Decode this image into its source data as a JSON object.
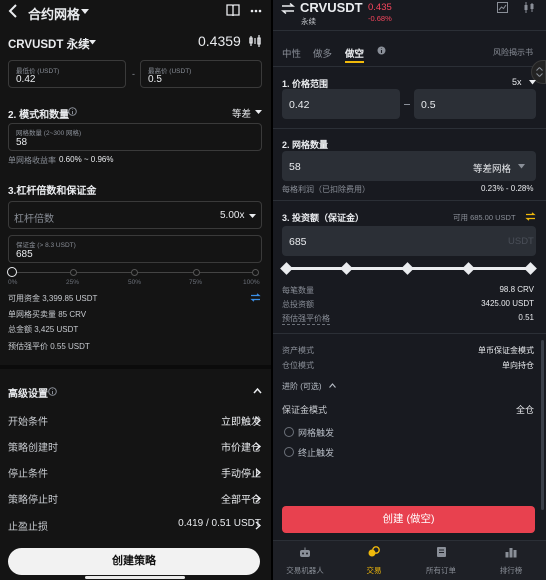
{
  "left": {
    "header": {
      "title": "合约网格"
    },
    "pair": {
      "symbol": "CRVUSDT 永续",
      "price": "0.4359"
    },
    "range": {
      "low_label": "最低价 (USDT)",
      "low_value": "0.42",
      "sep": "-",
      "high_label": "最高价 (USDT)",
      "high_value": "0.5"
    },
    "mode": {
      "title": "2. 模式和数量",
      "mode_value": "等差",
      "grid_label": "网格数量 (2~300 网格)",
      "grid_value": "58",
      "profit_label": "单网格收益率",
      "profit_value": "0.60% ~ 0.96%"
    },
    "leverage": {
      "title": "3.杠杆倍数和保证金",
      "lev_label": "杠杆倍数",
      "lev_value": "5.00x",
      "margin_label": "保证金 (> 8.3 USDT)",
      "margin_value": "685",
      "slider_marks": [
        "0%",
        "25%",
        "50%",
        "75%",
        "100%"
      ]
    },
    "info": {
      "available": "可用资金 3,399.85 USDT",
      "per_grid": "单网格买卖量 85 CRV",
      "total": "总金额 3,425 USDT",
      "liq": "预估强平价 0.55 USDT"
    },
    "advanced": {
      "title": "高级设置",
      "rows": [
        {
          "label": "开始条件",
          "value": "立即触发"
        },
        {
          "label": "策略创建时",
          "value": "市价建仓"
        },
        {
          "label": "停止条件",
          "value": "手动停止"
        },
        {
          "label": "策略停止时",
          "value": "全部平仓"
        },
        {
          "label": "止盈止损",
          "value": "0.419 / 0.51 USDT"
        }
      ]
    },
    "create_button": "创建策略"
  },
  "right": {
    "header": {
      "symbol": "CRVUSDT",
      "price": "0.435",
      "change": "-0.68%",
      "sub": "永续"
    },
    "tabs": [
      {
        "label": "中性"
      },
      {
        "label": "做多"
      },
      {
        "label": "做空"
      }
    ],
    "risk_link": "风险揭示书",
    "price_range": {
      "title": "1. 价格范围",
      "leverage": "5x",
      "low": "0.42",
      "high": "0.5"
    },
    "grid": {
      "title": "2. 网格数量",
      "value": "58",
      "mode": "等差网格",
      "profit_label": "每格利润（已扣除费用）",
      "profit_value": "0.23% - 0.28%"
    },
    "investment": {
      "title": "3. 投资额（保证金）",
      "available": "可用 685.00 USDT",
      "value": "685",
      "unit": "USDT"
    },
    "stats": [
      {
        "label": "每笔数量",
        "value": "98.8 CRV"
      },
      {
        "label": "总投资额",
        "value": "3425.00 USDT"
      },
      {
        "label": "预估强平价格",
        "value": "0.51"
      }
    ],
    "modes": [
      {
        "label": "资产模式",
        "value": "单币保证金模式"
      },
      {
        "label": "仓位模式",
        "value": "单向持仓"
      }
    ],
    "advanced": "进阶 (可选)",
    "margin_mode": {
      "label": "保证金模式",
      "value": "全仓"
    },
    "options": [
      {
        "label": "网格触发"
      },
      {
        "label": "终止触发"
      }
    ],
    "create_button": "创建 (做空)",
    "tabbar": [
      {
        "label": "交易机器人"
      },
      {
        "label": "交易"
      },
      {
        "label": "所有订单"
      },
      {
        "label": "排行榜"
      }
    ],
    "colors": {
      "accent": "#f0b90b",
      "sell": "#f6465d",
      "button": "#e8414f"
    }
  }
}
